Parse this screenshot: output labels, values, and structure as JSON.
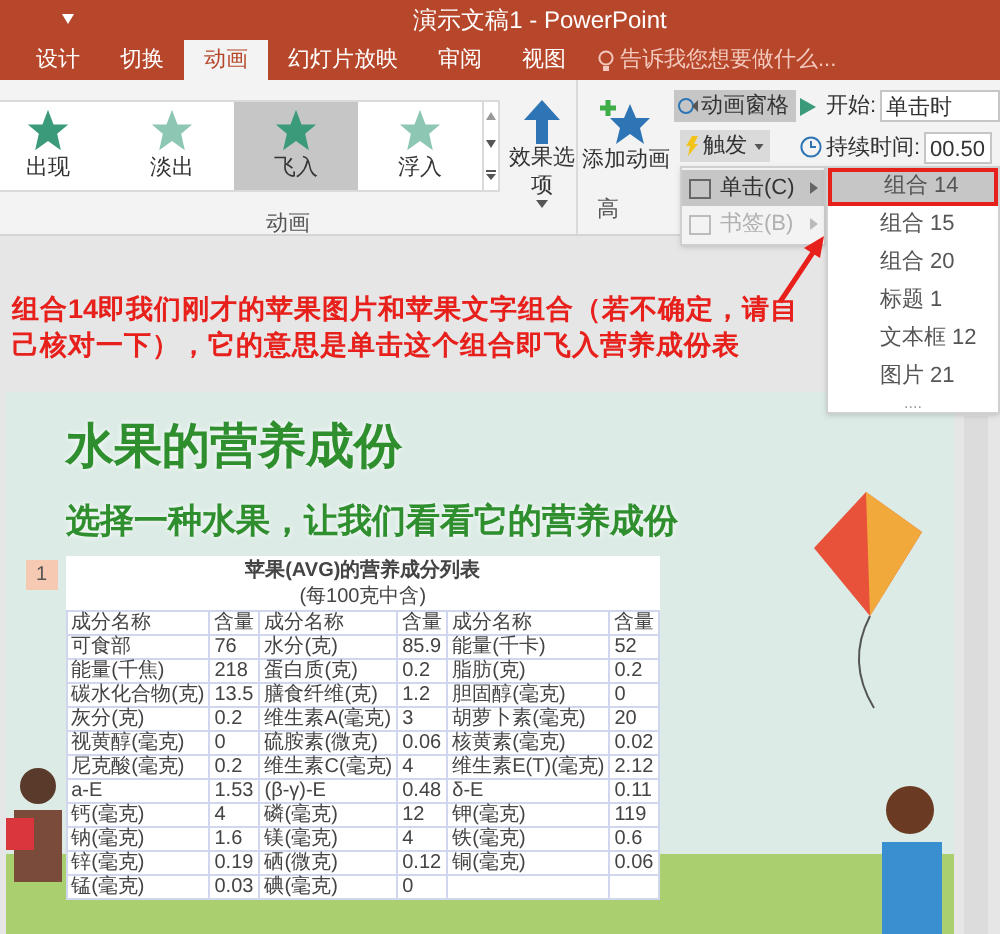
{
  "window": {
    "title": "演示文稿1 - PowerPoint"
  },
  "tabs": [
    {
      "label": "设计",
      "selected": false
    },
    {
      "label": "切换",
      "selected": false
    },
    {
      "label": "动画",
      "selected": true
    },
    {
      "label": "幻灯片放映",
      "selected": false
    },
    {
      "label": "审阅",
      "selected": false
    },
    {
      "label": "视图",
      "selected": false
    }
  ],
  "tell_me": {
    "placeholder": "告诉我您想要做什么..."
  },
  "ribbon": {
    "gallery": [
      {
        "label": "出现",
        "selected": false
      },
      {
        "label": "淡出",
        "selected": false
      },
      {
        "label": "飞入",
        "selected": true
      },
      {
        "label": "浮入",
        "selected": false
      }
    ],
    "effect_options": "效果选项",
    "group_label": "动画",
    "add_animation": "添加动画",
    "advanced_group_label": "高",
    "animation_pane": "动画窗格",
    "trigger": "触发",
    "start_label": "开始:",
    "start_value": "单击时",
    "duration_label": "持续时间:",
    "duration_value": "00.50"
  },
  "trigger_menu": [
    {
      "label": "单击(C)",
      "selected": true,
      "disabled": false
    },
    {
      "label": "书签(B)",
      "selected": false,
      "disabled": true
    }
  ],
  "submenu": {
    "items": [
      {
        "label": "组合 14",
        "selected": true
      },
      {
        "label": "组合 15",
        "selected": false
      },
      {
        "label": "组合 20",
        "selected": false
      },
      {
        "label": "标题 1",
        "selected": false
      },
      {
        "label": "文本框 12",
        "selected": false
      },
      {
        "label": "图片 21",
        "selected": false
      }
    ],
    "more": "...."
  },
  "annotation": "组合14即我们刚才的苹果图片和苹果文字组合（若不确定，请自己核对一下），它的意思是单击这个组合即飞入营养成份表",
  "slide": {
    "title": "水果的营养成份",
    "subtitle": "选择一种水果，让我们看看它的营养成份",
    "number": "1",
    "table": {
      "title": "苹果(AVG)的营养成分列表",
      "subtitle": "(每100克中含)",
      "header": [
        "成分名称",
        "含量",
        "成分名称",
        "含量",
        "成分名称",
        "含量"
      ],
      "rows": [
        [
          "可食部",
          "76",
          "水分(克)",
          "85.9",
          "能量(千卡)",
          "52"
        ],
        [
          "能量(千焦)",
          "218",
          "蛋白质(克)",
          "0.2",
          "脂肪(克)",
          "0.2"
        ],
        [
          "碳水化合物(克)",
          "13.5",
          "膳食纤维(克)",
          "1.2",
          "胆固醇(毫克)",
          "0"
        ],
        [
          "灰分(克)",
          "0.2",
          "维生素A(毫克)",
          "3",
          "胡萝卜素(毫克)",
          "20"
        ],
        [
          "视黄醇(毫克)",
          "0",
          "硫胺素(微克)",
          "0.06",
          "核黄素(毫克)",
          "0.02"
        ],
        [
          "尼克酸(毫克)",
          "0.2",
          "维生素C(毫克)",
          "4",
          "维生素E(T)(毫克)",
          "2.12"
        ],
        [
          "a-E",
          "1.53",
          "(β-γ)-E",
          "0.48",
          "δ-E",
          "0.11"
        ],
        [
          "钙(毫克)",
          "4",
          "磷(毫克)",
          "12",
          "钾(毫克)",
          "119"
        ],
        [
          "钠(毫克)",
          "1.6",
          "镁(毫克)",
          "4",
          "铁(毫克)",
          "0.6"
        ],
        [
          "锌(毫克)",
          "0.19",
          "硒(微克)",
          "0.12",
          "铜(毫克)",
          "0.06"
        ],
        [
          "锰(毫克)",
          "0.03",
          "碘(毫克)",
          "0",
          "",
          ""
        ]
      ]
    }
  }
}
